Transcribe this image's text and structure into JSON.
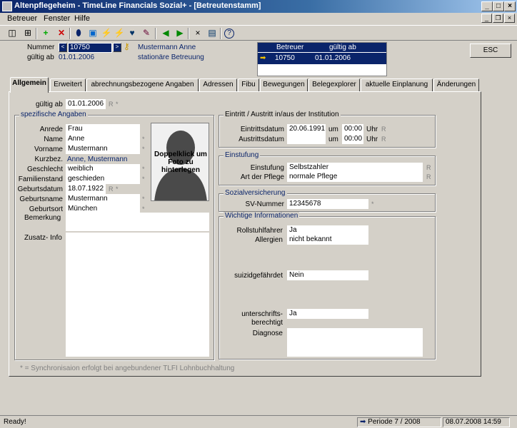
{
  "window": {
    "title": "Altenpflegeheim - TimeLine Financials Sozial+ - [Betreutenstamm]"
  },
  "menu": {
    "items": [
      "Betreuer",
      "Fenster",
      "Hilfe"
    ]
  },
  "header": {
    "nummer_label": "Nummer",
    "nummer_value": "10750",
    "person_name": "Mustermann Anne",
    "gueltig_label": "gültig ab",
    "gueltig_value": "01.01.2006",
    "care_type": "stationäre Betreuung",
    "esc_label": "ESC"
  },
  "betreuer_table": {
    "headers": [
      "Betreuer",
      "gültig ab"
    ],
    "rows": [
      {
        "betreuer": "10750",
        "gueltig": "01.01.2006"
      }
    ]
  },
  "tabs": [
    "Allgemein",
    "Erweitert",
    "abrechnungsbezogene Angaben",
    "Adressen",
    "Fibu",
    "Bewegungen",
    "Belegexplorer",
    "aktuelle Einplanung",
    "Änderungen"
  ],
  "general": {
    "gueltig_label": "gültig ab",
    "gueltig_value": "01.01.2006",
    "r_marker": "R",
    "star": "*"
  },
  "specific": {
    "title": "spezifische Angaben",
    "anrede": {
      "label": "Anrede",
      "value": "Frau"
    },
    "name": {
      "label": "Name",
      "value": "Anne"
    },
    "vorname": {
      "label": "Vorname",
      "value": "Mustermann"
    },
    "kurzbez": {
      "label": "Kurzbez.",
      "value": "Anne, Mustermann"
    },
    "geschlecht": {
      "label": "Geschlecht",
      "value": "weiblich"
    },
    "familienstand": {
      "label": "Familienstand",
      "value": "geschieden"
    },
    "geburtsdatum": {
      "label": "Geburtsdatum",
      "value": "18.07.1922"
    },
    "geburtsname": {
      "label": "Geburtsname",
      "value": "Mustermann"
    },
    "geburtsort": {
      "label": "Geburtsort",
      "value": "München"
    },
    "bemerkung_label": "Bemerkung",
    "zusatz_label": "Zusatz- Info",
    "photo_text": "Doppelklick um Foto zu hinterlegen"
  },
  "eintritt": {
    "title": "Eintritt / Austritt in/aus der Institution",
    "eintritt_label": "Eintrittsdatum",
    "eintritt_value": "20.06.1991",
    "eintritt_time": "00:00",
    "austritt_label": "Austrittsdatum",
    "austritt_value": "",
    "austritt_time": "00:00",
    "um": "um",
    "uhr": "Uhr"
  },
  "einstufung": {
    "title": "Einstufung",
    "einstufung_label": "Einstufung",
    "einstufung_value": "Selbstzahler",
    "pflege_label": "Art der Pflege",
    "pflege_value": "normale Pflege"
  },
  "sozial": {
    "title": "Sozialversicherung",
    "sv_label": "SV-Nummer",
    "sv_value": "12345678"
  },
  "wichtig": {
    "title": "Wichtige Informationen",
    "rollstuhl_label": "Rollstuhlfahrer",
    "rollstuhl_value": "Ja",
    "allergien_label": "Allergien",
    "allergien_value": "nicht bekannt",
    "suizid_label": "suizidgefährdet",
    "suizid_value": "Nein",
    "unterschrift_label1": "unterschrifts-",
    "unterschrift_label2": "berechtigt",
    "unterschrift_value": "Ja",
    "diagnose_label": "Diagnose"
  },
  "footnote": "* = Synchronisaion erfolgt bei angebundener TLFI Lohnbuchhaltung",
  "status": {
    "ready": "Ready!",
    "periode": "Periode  7 / 2008",
    "datetime": "08.07.2008 14:59"
  },
  "colors": {
    "titlebar": "#0a246a",
    "accent": "#0a246a",
    "grid_header": "#0a246a"
  }
}
